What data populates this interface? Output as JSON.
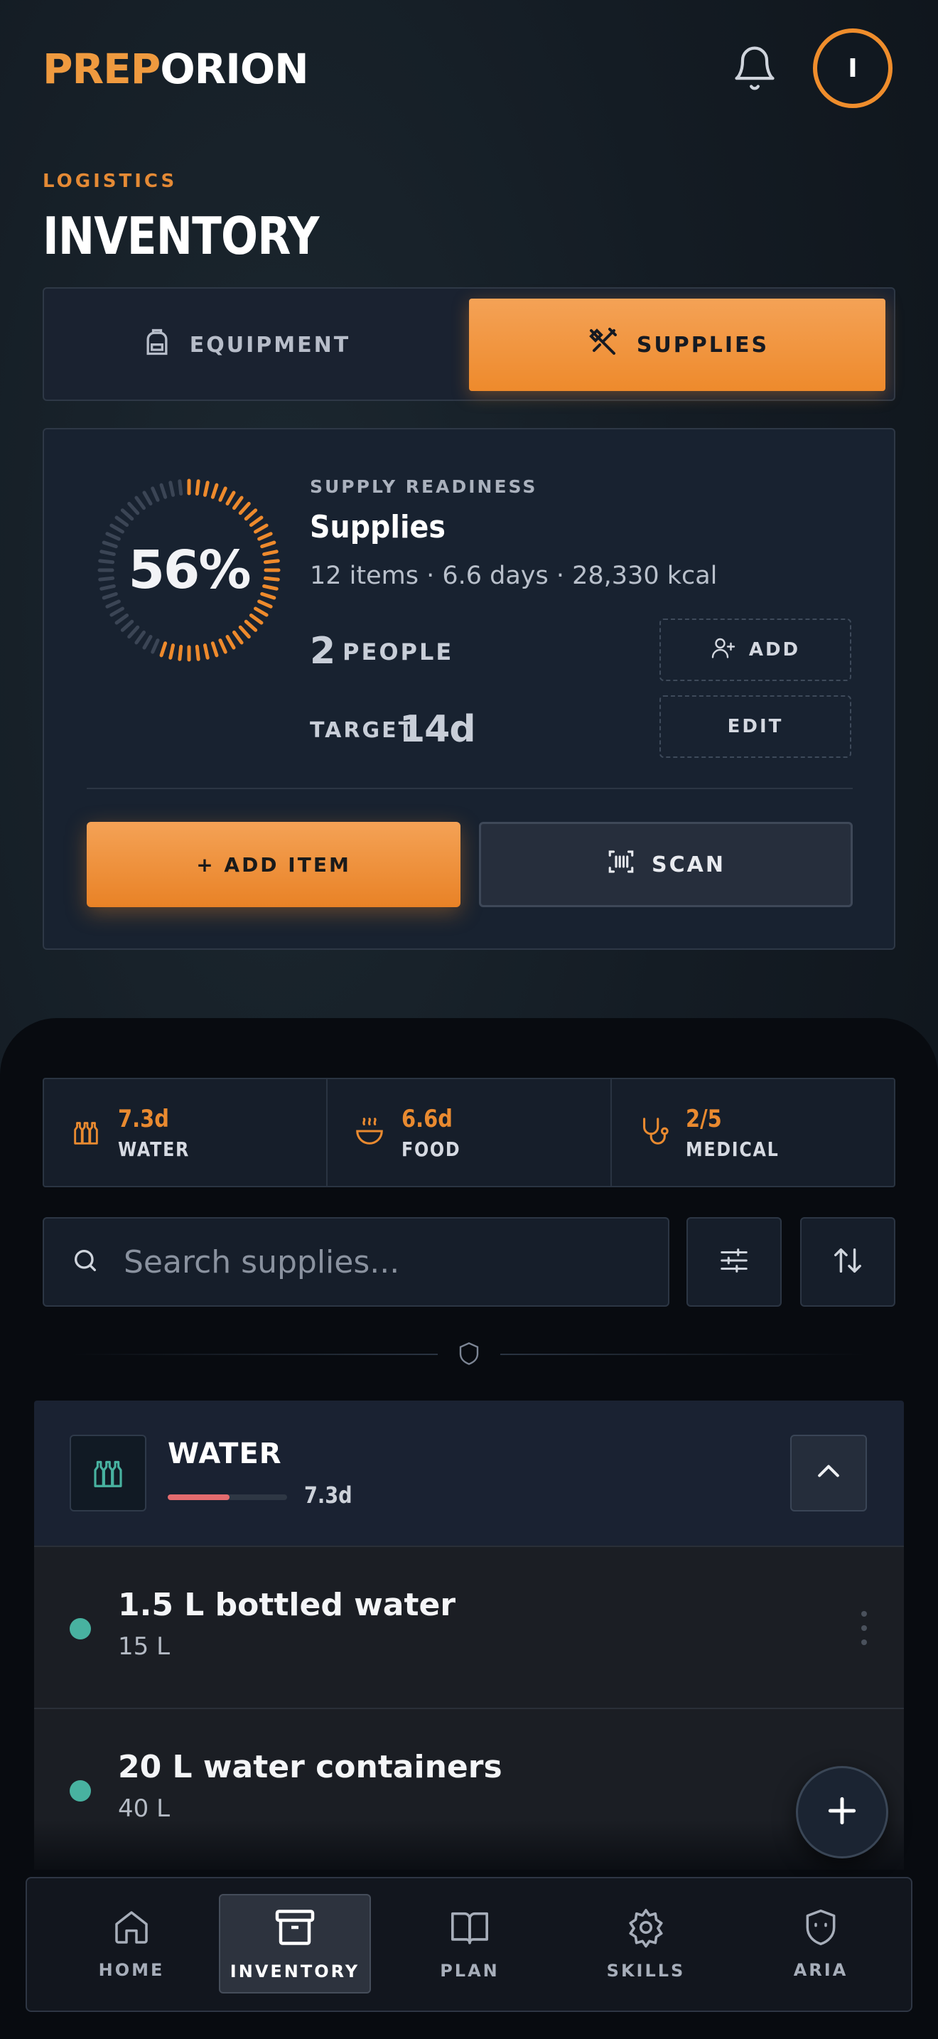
{
  "brand": {
    "name_part1": "P",
    "name_part2": "REP",
    "name_part3": "ORION"
  },
  "header": {
    "avatar_initial": "I"
  },
  "page": {
    "eyebrow": "LOGISTICS",
    "title": "INVENTORY"
  },
  "tabs": [
    {
      "label": "EQUIPMENT",
      "icon": "backpack-icon",
      "active": false
    },
    {
      "label": "SUPPLIES",
      "icon": "utensils-icon",
      "active": true
    }
  ],
  "readiness": {
    "percent_label": "56%",
    "percent_value": 0.56,
    "eyebrow": "SUPPLY READINESS",
    "title": "Supplies",
    "stats": "12 items · 6.6 days · 28,330 kcal",
    "people_count": "2",
    "people_label": "PEOPLE",
    "add_label": "ADD",
    "target_label": "TARGET",
    "target_value": "14d",
    "edit_label": "EDIT",
    "add_item_label": "+ ADD ITEM",
    "scan_label": "SCAN"
  },
  "summary": [
    {
      "value": "7.3d",
      "label": "WATER",
      "icon": "bottles-icon"
    },
    {
      "value": "6.6d",
      "label": "FOOD",
      "icon": "bowl-icon"
    },
    {
      "value": "2/5",
      "label": "MEDICAL",
      "icon": "stethoscope-icon"
    }
  ],
  "search": {
    "placeholder": "Search supplies..."
  },
  "category": {
    "title": "WATER",
    "days": "7.3d",
    "progress": 0.52,
    "colors": {
      "progress": "#e36b6e",
      "status_dot": "#48b2a0"
    }
  },
  "items": [
    {
      "name": "1.5 L bottled water",
      "qty": "15 L"
    },
    {
      "name": "20 L water containers",
      "qty": "40 L"
    }
  ],
  "nav": [
    {
      "label": "HOME",
      "icon": "home-icon",
      "active": false
    },
    {
      "label": "INVENTORY",
      "icon": "archive-box-icon",
      "active": true
    },
    {
      "label": "PLAN",
      "icon": "book-icon",
      "active": false
    },
    {
      "label": "SKILLS",
      "icon": "gear-icon",
      "active": false
    },
    {
      "label": "ARIA",
      "icon": "shield-face-icon",
      "active": false
    }
  ],
  "theme": {
    "accent": "#ee8a2c",
    "background": "#141c24"
  }
}
